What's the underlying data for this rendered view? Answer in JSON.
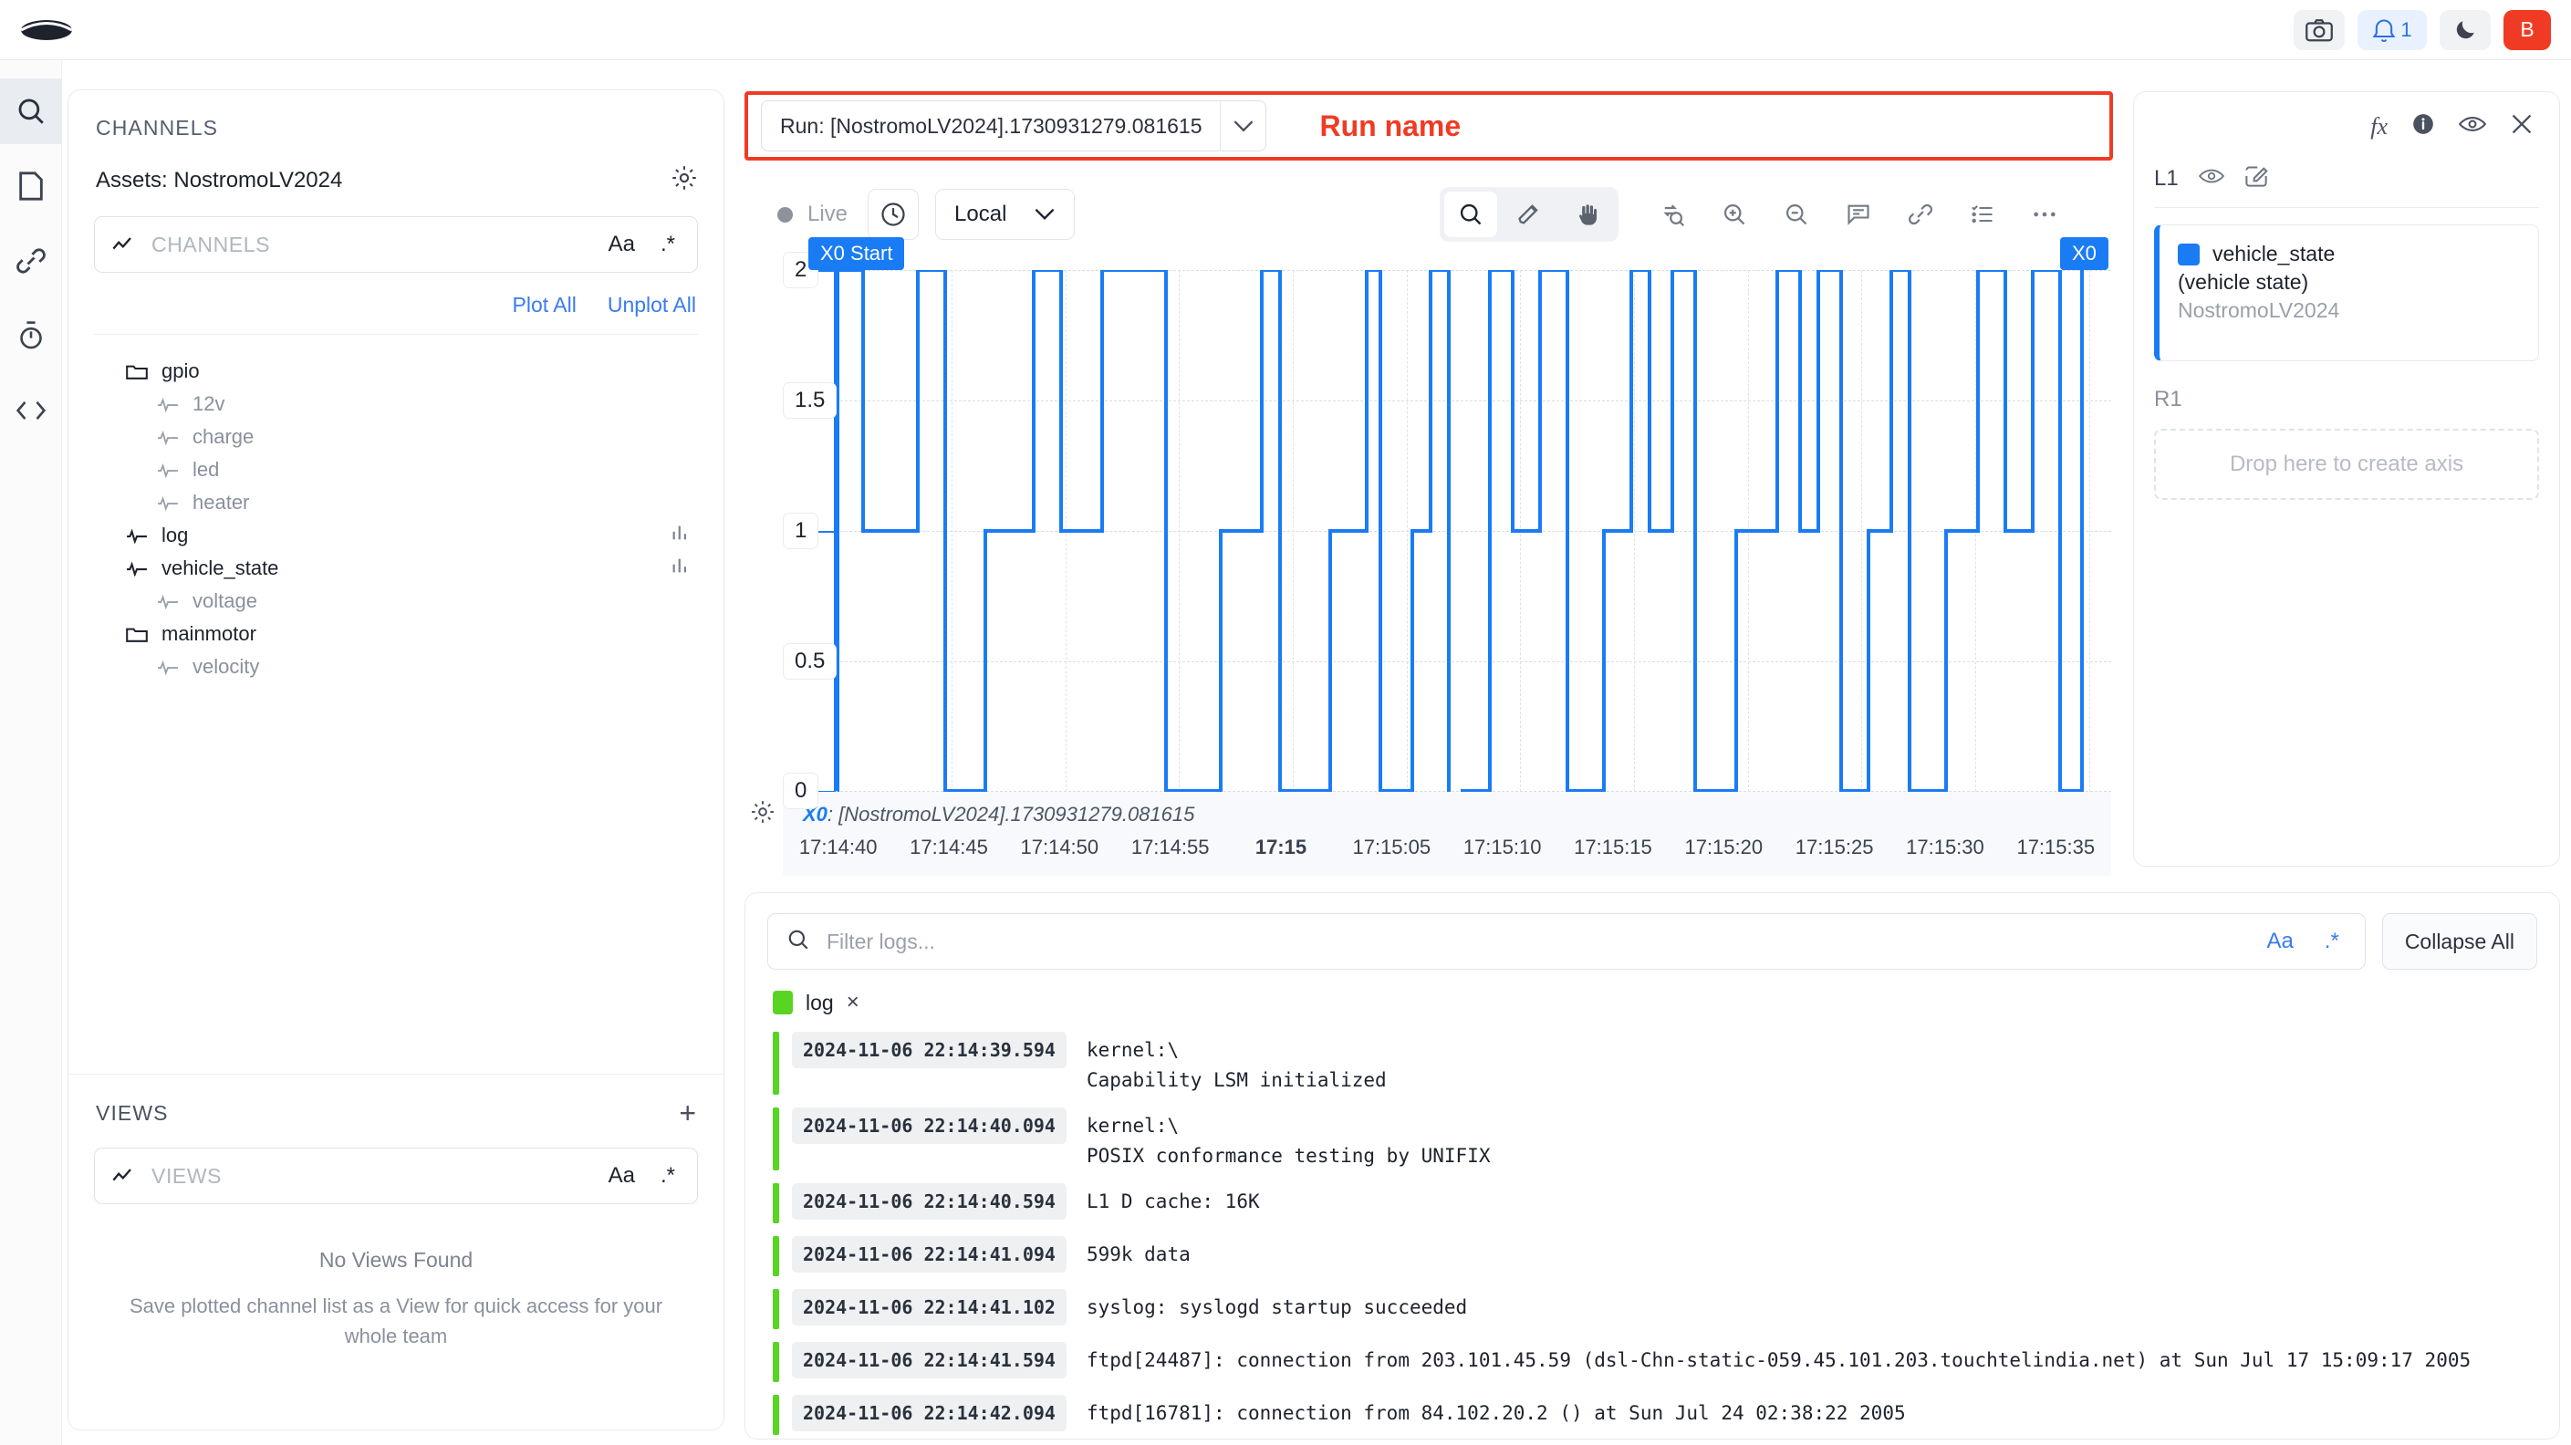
{
  "topbar": {
    "logo_name": "app-logo",
    "camera_label": "camera-icon",
    "notification_count": "1",
    "avatar_initial": "B",
    "accent_red": "#f03b24",
    "accent_blue": "#2f6fe4"
  },
  "rail": {
    "items": [
      {
        "name": "search",
        "icon": "search-icon",
        "active": true
      },
      {
        "name": "notes",
        "icon": "page-icon",
        "active": false
      },
      {
        "name": "links",
        "icon": "link-icon",
        "active": false
      },
      {
        "name": "timer",
        "icon": "stopwatch-icon",
        "active": false
      },
      {
        "name": "code",
        "icon": "code-icon",
        "active": false
      }
    ]
  },
  "channels_panel": {
    "title": "CHANNELS",
    "assets_label": "Assets: NostromoLV2024",
    "gear_icon": "gear-icon",
    "search_placeholder": "CHANNELS",
    "case_flag": "Aa",
    "regex_flag": ".*",
    "plot_all": "Plot All",
    "unplot_all": "Unplot All",
    "tree": [
      {
        "label": "gpio",
        "type": "folder",
        "depth": 0,
        "dim": false,
        "bars": false
      },
      {
        "label": "12v",
        "type": "channel",
        "depth": 1,
        "dim": true,
        "bars": false
      },
      {
        "label": "charge",
        "type": "channel",
        "depth": 1,
        "dim": true,
        "bars": false
      },
      {
        "label": "led",
        "type": "channel",
        "depth": 1,
        "dim": true,
        "bars": false
      },
      {
        "label": "heater",
        "type": "channel",
        "depth": 1,
        "dim": true,
        "bars": false
      },
      {
        "label": "log",
        "type": "channel",
        "depth": 0,
        "dim": false,
        "bars": true
      },
      {
        "label": "vehicle_state",
        "type": "channel",
        "depth": 0,
        "dim": false,
        "bars": true
      },
      {
        "label": "voltage",
        "type": "channel",
        "depth": 1,
        "dim": true,
        "bars": false
      },
      {
        "label": "mainmotor",
        "type": "folder",
        "depth": 0,
        "dim": false,
        "bars": false
      },
      {
        "label": "velocity",
        "type": "channel",
        "depth": 1,
        "dim": true,
        "bars": false
      }
    ]
  },
  "views_panel": {
    "title": "VIEWS",
    "add_label": "+",
    "search_placeholder": "VIEWS",
    "case_flag": "Aa",
    "regex_flag": ".*",
    "empty_title": "No Views Found",
    "empty_subtitle": "Save plotted channel list as a View for quick access for your whole team"
  },
  "run_header": {
    "selected_run": "Run: [NostromoLV2024].1730931279.081615",
    "caret_icon": "chevron-down-icon",
    "annotation": "Run name",
    "annotation_color": "#f03b24"
  },
  "chart_toolbar": {
    "live_label": "Live",
    "live_dot_color": "#8d939d",
    "clock_icon": "clock-icon",
    "timezone": "Local",
    "timezone_caret": "chevron-down-icon",
    "mode_tools": [
      {
        "name": "zoom-select-icon",
        "selected": true
      },
      {
        "name": "highlighter-icon",
        "selected": false
      },
      {
        "name": "pan-hand-icon",
        "selected": false
      }
    ],
    "action_tools": [
      {
        "name": "reset-zoom-icon"
      },
      {
        "name": "zoom-in-icon"
      },
      {
        "name": "zoom-out-icon"
      },
      {
        "name": "annotation-icon"
      },
      {
        "name": "link-icon"
      },
      {
        "name": "checklist-icon"
      },
      {
        "name": "more-options-icon"
      }
    ]
  },
  "chart_data": {
    "type": "line",
    "title": "",
    "xlabel": "",
    "ylabel": "",
    "ylim": [
      0,
      2
    ],
    "yticks": [
      "0",
      "0.5",
      "1",
      "1.5",
      "2"
    ],
    "xticks": [
      "17:14:40",
      "17:14:45",
      "17:14:50",
      "17:14:55",
      "17:15",
      "17:15:05",
      "17:15:10",
      "17:15:15",
      "17:15:20",
      "17:15:25",
      "17:15:30",
      "17:15:35"
    ],
    "xtick_bold_index": 4,
    "grid": true,
    "legend_position": "right",
    "series": [
      {
        "name": "vehicle_state",
        "color": "#1a7cf5",
        "step": true,
        "x": [
          0.0,
          1.2,
          3.0,
          4.2,
          5.0,
          7.2,
          8.6,
          10.2,
          12.0,
          13.6,
          15.6,
          17.6,
          19.2,
          21.4,
          22.6,
          24.6,
          26.6,
          28.2,
          30.0,
          31.6,
          33.2,
          34.6,
          36.4,
          38.2,
          40.0,
          41.4,
          43.0,
          44.6,
          46.0,
          47.8,
          49.4,
          51.0,
          52.6,
          54.2,
          56.0,
          57.6,
          59.2,
          60.0
        ],
        "y": [
          2,
          1,
          2,
          1,
          2,
          0,
          2,
          1,
          0,
          1,
          2,
          1,
          0,
          1,
          2,
          0,
          2,
          0,
          2,
          1,
          2,
          0,
          2,
          1,
          2,
          0,
          2,
          1,
          0,
          2,
          1,
          2,
          0,
          1,
          2,
          0,
          2,
          2
        ]
      }
    ],
    "cursors": [
      {
        "label": "X0 Start",
        "position": "left",
        "color": "#1a7cf5"
      },
      {
        "label": "X0",
        "position": "right",
        "color": "#1a7cf5"
      }
    ],
    "cursor_caption_prefix": "X0",
    "cursor_caption_value": ": [NostromoLV2024].1730931279.081615",
    "gear_icon": "gear-icon"
  },
  "axes_panel": {
    "top_icons": [
      {
        "name": "function-fx-icon",
        "label": "fx"
      },
      {
        "name": "info-icon"
      },
      {
        "name": "eye-icon"
      },
      {
        "name": "close-icon"
      }
    ],
    "left_axis_label": "L1",
    "left_axis_eye": "eye-icon",
    "left_axis_edit": "edit-icon",
    "legend": [
      {
        "swatch_color": "#1a7cf5",
        "name": "vehicle_state",
        "unit": "(vehicle state)",
        "asset": "NostromoLV2024"
      }
    ],
    "right_axis_label": "R1",
    "dropzone_text": "Drop here to create axis"
  },
  "log_panel": {
    "filter_placeholder": "Filter logs...",
    "search_icon": "search-icon",
    "case_flag": "Aa",
    "regex_flag": ".*",
    "collapse_all": "Collapse All",
    "chips": [
      {
        "label": "log",
        "color": "#58d423",
        "close": "×"
      }
    ],
    "rows": [
      {
        "timestamp": "2024-11-06 22:14:39.594",
        "message": "kernel:\\\nCapability LSM initialized",
        "bar_color": "#58d423"
      },
      {
        "timestamp": "2024-11-06 22:14:40.094",
        "message": "kernel:\\\nPOSIX conformance testing by UNIFIX",
        "bar_color": "#58d423"
      },
      {
        "timestamp": "2024-11-06 22:14:40.594",
        "message": "L1 D cache: 16K",
        "bar_color": "#58d423"
      },
      {
        "timestamp": "2024-11-06 22:14:41.094",
        "message": "599k data",
        "bar_color": "#58d423"
      },
      {
        "timestamp": "2024-11-06 22:14:41.102",
        "message": "syslog: syslogd startup succeeded",
        "bar_color": "#58d423"
      },
      {
        "timestamp": "2024-11-06 22:14:41.594",
        "message": "ftpd[24487]: connection from 203.101.45.59 (dsl-Chn-static-059.45.101.203.touchtelindia.net) at Sun Jul 17 15:09:17 2005",
        "bar_color": "#58d423"
      },
      {
        "timestamp": "2024-11-06 22:14:42.094",
        "message": "ftpd[16781]: connection from 84.102.20.2 () at Sun Jul 24 02:38:22 2005",
        "bar_color": "#58d423"
      }
    ]
  }
}
